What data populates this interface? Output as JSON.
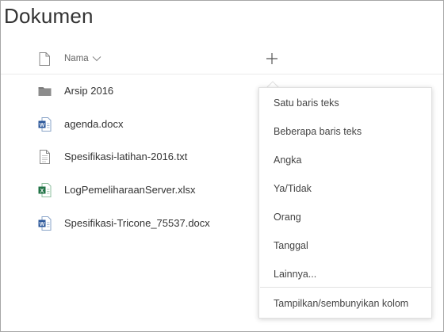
{
  "page": {
    "title": "Dokumen"
  },
  "header": {
    "name_column_label": "Nama",
    "add_column_glyph": "+"
  },
  "files": [
    {
      "name": "Arsip 2016",
      "type": "folder",
      "icon": "folder-icon"
    },
    {
      "name": "agenda.docx",
      "type": "word",
      "icon": "word-doc-icon"
    },
    {
      "name": "Spesifikasi-latihan-2016.txt",
      "type": "text",
      "icon": "text-file-icon"
    },
    {
      "name": "LogPemeliharaanServer.xlsx",
      "type": "excel",
      "icon": "excel-doc-icon"
    },
    {
      "name": "Spesifikasi-Tricone_75537.docx",
      "type": "word",
      "icon": "word-doc-icon"
    }
  ],
  "column_menu": {
    "items": [
      "Satu baris teks",
      "Beberapa baris teks",
      "Angka",
      "Ya/Tidak",
      "Orang",
      "Tanggal",
      "Lainnya..."
    ],
    "footer_item": "Tampilkan/sembunyikan kolom"
  },
  "colors": {
    "word_blue": "#2b579a",
    "excel_green": "#217346",
    "folder_gray": "#7a7a7a",
    "text_primary": "#333333",
    "frame_border": "#a6a6a6"
  }
}
